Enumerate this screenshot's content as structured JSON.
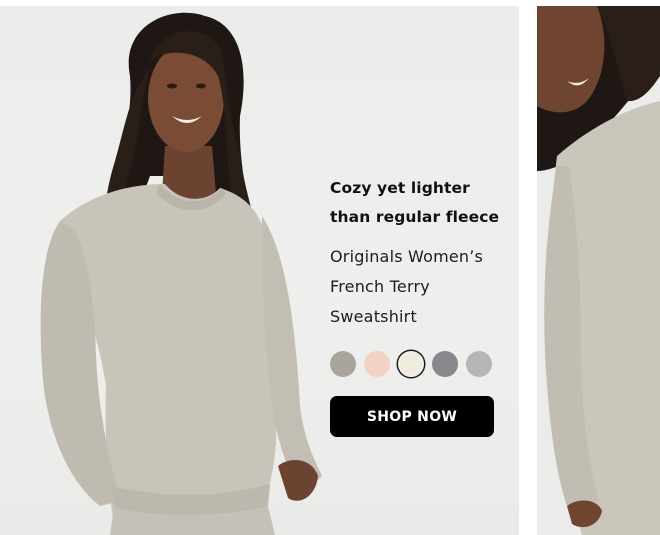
{
  "promo": {
    "headline_line1": "Cozy yet lighter",
    "headline_line2": "than regular fleece",
    "product_line1": "Originals Women’s",
    "product_line2": "French Terry",
    "product_line3": "Sweatshirt",
    "cta_label": "SHOP NOW"
  },
  "swatches": [
    {
      "name": "taupe",
      "color": "#aaa59c",
      "selected": false
    },
    {
      "name": "blush",
      "color": "#f3d2c6",
      "selected": false
    },
    {
      "name": "cream",
      "color": "#f0ebdc",
      "selected": true
    },
    {
      "name": "charcoal",
      "color": "#86888c",
      "selected": false
    },
    {
      "name": "light-grey",
      "color": "#b4b6b8",
      "selected": false
    }
  ],
  "colors": {
    "background": "#efefed",
    "sweatshirt": "#c9c4ba",
    "button": "#000000"
  }
}
